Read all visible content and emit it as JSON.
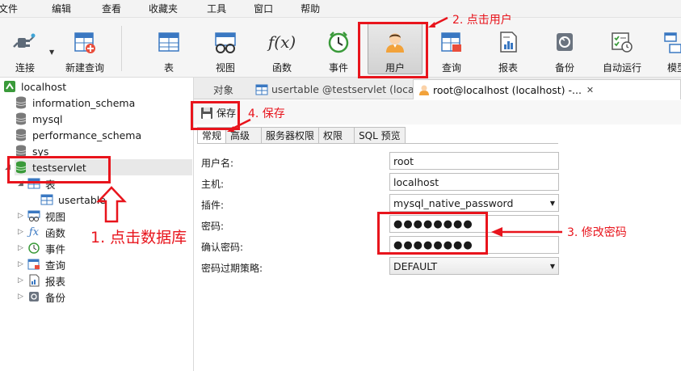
{
  "menubar": {
    "items": [
      "文件",
      "编辑",
      "查看",
      "收藏夹",
      "工具",
      "窗口",
      "帮助"
    ]
  },
  "toolbar": {
    "buttons": [
      {
        "label": "连接",
        "icon": "plug-icon"
      },
      {
        "label": "新建查询",
        "icon": "new-query-icon"
      },
      {
        "label": "表",
        "icon": "table-icon"
      },
      {
        "label": "视图",
        "icon": "view-icon"
      },
      {
        "label": "函数",
        "icon": "function-icon"
      },
      {
        "label": "事件",
        "icon": "clock-icon"
      },
      {
        "label": "用户",
        "icon": "user-icon"
      },
      {
        "label": "查询",
        "icon": "query-icon"
      },
      {
        "label": "报表",
        "icon": "report-icon"
      },
      {
        "label": "备份",
        "icon": "backup-icon"
      },
      {
        "label": "自动运行",
        "icon": "schedule-icon"
      },
      {
        "label": "模型",
        "icon": "model-icon"
      }
    ],
    "fx_glyph": "f(x)"
  },
  "sidebar": {
    "connection": "localhost",
    "databases": [
      "information_schema",
      "mysql",
      "performance_schema",
      "sys",
      "testservlet"
    ],
    "children": [
      {
        "label": "表"
      },
      {
        "label": "usertable"
      },
      {
        "label": "视图"
      },
      {
        "label": "函数"
      },
      {
        "label": "事件"
      },
      {
        "label": "查询"
      },
      {
        "label": "报表"
      },
      {
        "label": "备份"
      }
    ]
  },
  "tabs": {
    "objects": "对象",
    "usertable": "usertable @testservlet (loca...",
    "user": "root@localhost (localhost) -...",
    "close": "✕"
  },
  "editor": {
    "save_label": "保存",
    "subtabs": [
      "常规",
      "高级",
      "服务器权限",
      "权限",
      "SQL 预览"
    ],
    "fields": {
      "username_label": "用户名:",
      "username_value": "root",
      "host_label": "主机:",
      "host_value": "localhost",
      "plugin_label": "插件:",
      "plugin_value": "mysql_native_password",
      "password_label": "密码:",
      "password_value": "●●●●●●●●",
      "confirm_label": "确认密码:",
      "confirm_value": "●●●●●●●●",
      "expire_label": "密码过期策略:",
      "expire_value": "DEFAULT"
    }
  },
  "annotations": {
    "step1": "1. 点击数据库",
    "step2": "2. 点击用户",
    "step3": "3. 修改密码",
    "step4": "4. 保存"
  },
  "colors": {
    "annotation": "#e8141c",
    "db_green": "#3a9a3a",
    "table_blue": "#3a78c2"
  }
}
